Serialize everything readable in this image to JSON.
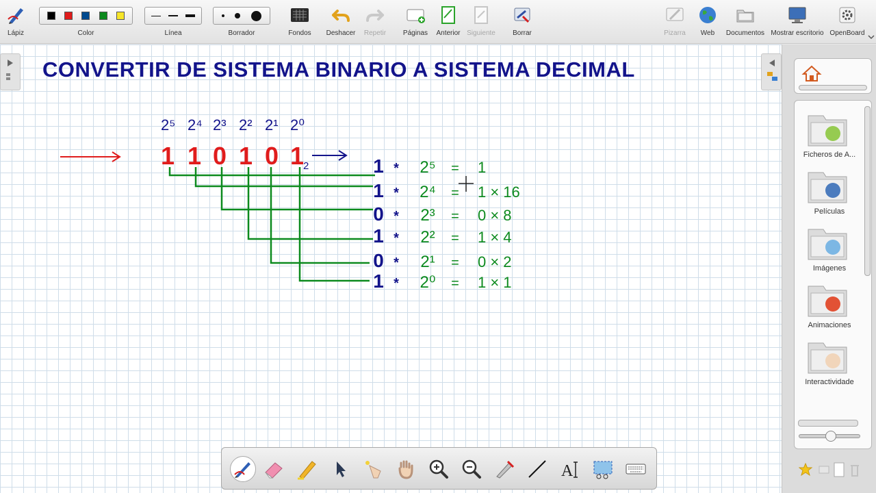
{
  "toolbar": {
    "lapiz": "Lápiz",
    "color": "Color",
    "linea": "Línea",
    "borrador": "Borrador",
    "fondos": "Fondos",
    "deshacer": "Deshacer",
    "repetir": "Repetir",
    "paginas": "Páginas",
    "anterior": "Anterior",
    "siguiente": "Siguiente",
    "borrar": "Borrar",
    "pizarra": "Pizarra",
    "web": "Web",
    "documentos": "Documentos",
    "mostrar_escritorio": "Mostrar escritorio",
    "openboard": "OpenBoard",
    "colors": [
      "#000000",
      "#e01c1c",
      "#004a8f",
      "#0c8a1e",
      "#f7e62a"
    ]
  },
  "board": {
    "title": "CONVERTIR DE SISTEMA BINARIO A SISTEMA DECIMAL",
    "powers": [
      "2⁵",
      "2⁴",
      "2³",
      "2²",
      "2¹",
      "2⁰"
    ],
    "binary_digits": [
      "1",
      "1",
      "0",
      "1",
      "0",
      "1"
    ],
    "base_subscript": "2",
    "rows": [
      {
        "digit": "1",
        "op": "*",
        "power": "2⁵",
        "eq": "=",
        "result": "1"
      },
      {
        "digit": "1",
        "op": "*",
        "power": "2⁴",
        "eq": "=",
        "result": "1 × 16"
      },
      {
        "digit": "0",
        "op": "*",
        "power": "2³",
        "eq": "=",
        "result": "0 × 8"
      },
      {
        "digit": "1",
        "op": "*",
        "power": "2²",
        "eq": "=",
        "result": "1 × 4"
      },
      {
        "digit": "0",
        "op": "*",
        "power": "2¹",
        "eq": "=",
        "result": "0 × 2"
      },
      {
        "digit": "1",
        "op": "*",
        "power": "2⁰",
        "eq": "=",
        "result": "1 × 1"
      }
    ],
    "colors": {
      "title": "#13148b",
      "digits": "#e01c1c",
      "lines": "#0c8a1e",
      "blue_ink": "#13148b",
      "arrow": "#e01c1c"
    }
  },
  "library": {
    "items": [
      "Ficheros de A...",
      "Películas",
      "Imágenes",
      "Animaciones",
      "Interactividade"
    ]
  },
  "bottom_tools": [
    "pen",
    "eraser",
    "highlighter",
    "pointer",
    "laser",
    "hand",
    "zoom-in",
    "zoom-out",
    "capture",
    "line",
    "text",
    "selection",
    "keyboard"
  ]
}
